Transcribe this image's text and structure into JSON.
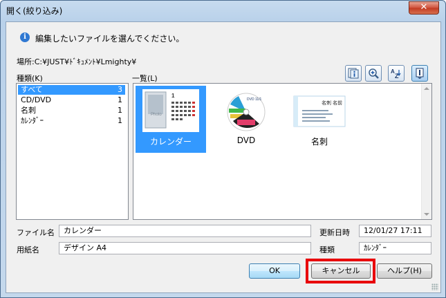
{
  "window": {
    "title": "開く(絞り込み)",
    "close_glyph": "✕"
  },
  "info": {
    "icon": "info-icon",
    "icon_glyph": "i",
    "message": "編集したいファイルを選んでください。"
  },
  "location": {
    "text": "場所:C:¥JUST¥ﾄﾞｷｭﾒﾝﾄ¥Lmighty¥"
  },
  "kinds": {
    "label": "種類(K)",
    "items": [
      {
        "name": "すべて",
        "count": "3",
        "selected": true
      },
      {
        "name": "CD/DVD",
        "count": "1",
        "selected": false
      },
      {
        "name": "名刺",
        "count": "1",
        "selected": false
      },
      {
        "name": "ｶﾚﾝﾀﾞｰ",
        "count": "1",
        "selected": false
      }
    ]
  },
  "list": {
    "label": "一覧(L)",
    "items": [
      {
        "label": "カレンダー",
        "selected": true,
        "icon": "calendar-thumbnail"
      },
      {
        "label": "DVD",
        "selected": false,
        "icon": "dvd-thumbnail"
      },
      {
        "label": "名刺",
        "selected": false,
        "icon": "business-card-thumbnail"
      }
    ]
  },
  "toolbar": {
    "icons": [
      "info-view-icon",
      "zoom-icon",
      "sort-az-icon",
      "detail-view-icon"
    ]
  },
  "fields": {
    "filename_label": "ファイル名",
    "filename_value": "カレンダー",
    "paper_label": "用紙名",
    "paper_value": "デザイン A4",
    "updated_label": "更新日時",
    "updated_value": "12/01/27 17:11",
    "kind_label": "種類",
    "kind_value": "ｶﾚﾝﾀﾞｰ"
  },
  "buttons": {
    "ok": "OK",
    "cancel": "キャンセル",
    "help": "ヘルプ(H)"
  },
  "colors": {
    "selection": "#3399ff",
    "highlight": "#e8000b",
    "close": "#c23a22"
  }
}
